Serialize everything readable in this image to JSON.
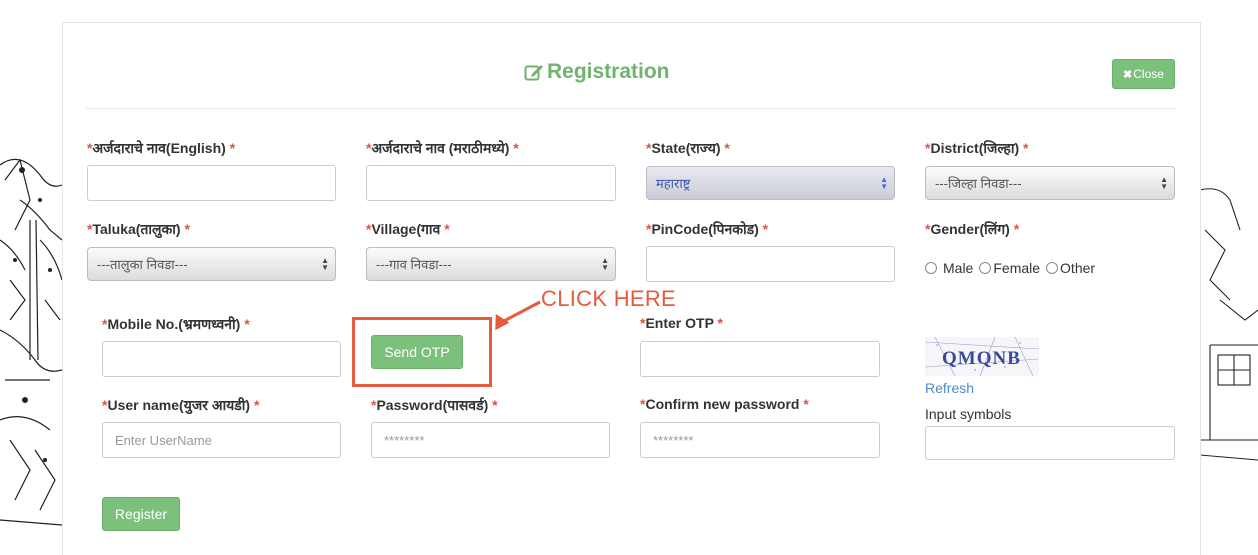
{
  "title": "Registration",
  "close_label": "Close",
  "fields": {
    "name_en": {
      "label": "अर्जदाराचे नाव(English)"
    },
    "name_mr": {
      "label": "अर्जदाराचे नाव (मराठीमध्ये)"
    },
    "state": {
      "label": "State(राज्य)",
      "value": "महाराष्ट्र"
    },
    "district": {
      "label": "District(जिल्हा)",
      "value": "---जिल्हा निवडा---"
    },
    "taluka": {
      "label": "Taluka(तालुका)",
      "value": "---तालुका निवडा---"
    },
    "village": {
      "label": "Village(गाव",
      "value": "---गाव निवडा---"
    },
    "pincode": {
      "label": "PinCode(पिनकोड)"
    },
    "gender": {
      "label": "Gender(लिंग)",
      "options": [
        "Male",
        "Female",
        "Other"
      ]
    },
    "mobile": {
      "label": "Mobile No.(भ्रमणध्वनी)"
    },
    "otp": {
      "label": "Enter OTP"
    },
    "username": {
      "label": "User name(युजर आयडी)",
      "placeholder": "Enter UserName"
    },
    "password": {
      "label": "Password(पासवर्ड)",
      "placeholder": "********"
    },
    "confirm_password": {
      "label": "Confirm new password",
      "placeholder": "********"
    }
  },
  "send_otp_label": "Send OTP",
  "annotation": "CLICK HERE",
  "captcha": {
    "text": "QMQNB",
    "refresh_label": "Refresh",
    "input_label": "Input symbols"
  },
  "register_label": "Register",
  "required_mark": "*",
  "colors": {
    "accent_green": "#7bc17b",
    "title_green": "#6fb36f",
    "required_red": "#d9534f",
    "annotation_red": "#e85a3c",
    "link_blue": "#4a8bc4"
  }
}
